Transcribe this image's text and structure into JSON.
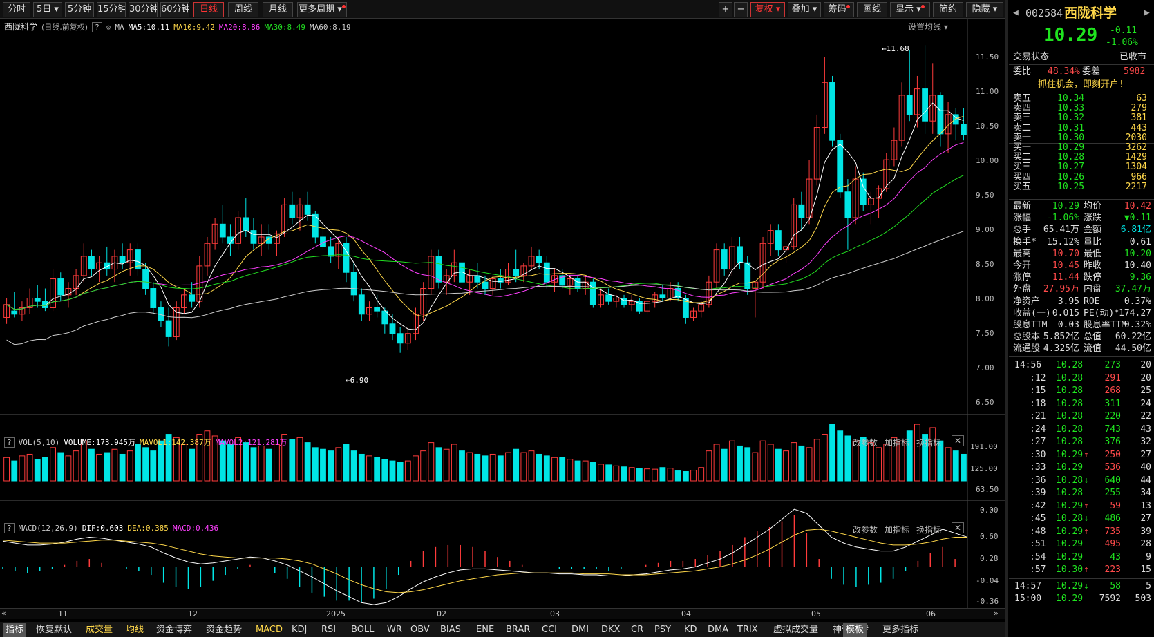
{
  "periods": [
    "分时",
    "5日",
    "5分钟",
    "15分钟",
    "30分钟",
    "60分钟",
    "日线",
    "周线",
    "月线",
    "更多周期"
  ],
  "tools": {
    "plus": "+",
    "minus": "−",
    "fuquan": "复权",
    "overlay": "叠加",
    "chips": "筹码",
    "draw": "画线",
    "display": "显示",
    "simple": "简约",
    "hide": "隐藏"
  },
  "stock": {
    "code": "002584",
    "name": "西陇科学",
    "price": "10.29",
    "change": "-0.11",
    "pct": "-1.06%"
  },
  "main_legend": {
    "title": "西陇科学",
    "subtitle": "(日线,前复权)",
    "q": "?",
    "ma": "MA",
    "ma5": "MA5:10.11",
    "ma10": "MA10:9.42",
    "ma20": "MA20:8.86",
    "ma30": "MA30:8.49",
    "ma60": "MA60:8.19",
    "settings": "设置均线"
  },
  "vol_legend": {
    "q": "?",
    "name": "VOL(5,10)",
    "volume": "VOLUME:173.945万",
    "mavol1": "MAVOL1:142.387万",
    "mavol2": "MAVOL2:121.281万"
  },
  "macd_legend": {
    "q": "?",
    "name": "MACD(12,26,9)",
    "dif": "DIF:0.603",
    "dea": "DEA:0.385",
    "macd": "MACD:0.436"
  },
  "panel_btns": {
    "param": "改参数",
    "add": "加指标",
    "swap": "换指标",
    "close": "✕"
  },
  "price_axis": [
    "11.50",
    "11.00",
    "10.50",
    "10.00",
    "9.50",
    "9.00",
    "8.50",
    "8.00",
    "7.50",
    "7.00",
    "6.50"
  ],
  "vol_axis": [
    "191.00",
    "125.00",
    "63.50",
    "0.00"
  ],
  "macd_axis": [
    "0.60",
    "0.28",
    "-0.04",
    "-0.36"
  ],
  "x_labels": [
    "11",
    "12",
    "2025",
    "02",
    "03",
    "04",
    "05",
    "06"
  ],
  "annot": {
    "high": "11.68",
    "low": "6.90"
  },
  "bottom_tabs": [
    "指标",
    "恢复默认",
    "成交量",
    "均线",
    "资金博弈",
    "资金趋势",
    "MACD",
    "KDJ",
    "RSI",
    "BOLL",
    "WR",
    "OBV",
    "BIAS",
    "ENE",
    "BRAR",
    "CCI",
    "DMI",
    "DKX",
    "CR",
    "PSY",
    "KD",
    "DMA",
    "TRIX",
    "虚拟成交量",
    "神奇九转",
    "更多指标",
    "模板"
  ],
  "quote": {
    "state_label": "交易状态",
    "state": "已收市",
    "wb_label": "委比",
    "wb": "48.34%",
    "wc_label": "委差",
    "wc": "5982",
    "promo": "抓住机会，即刻开户!",
    "asks": [
      [
        "卖五",
        "10.34",
        "63"
      ],
      [
        "卖四",
        "10.33",
        "279"
      ],
      [
        "卖三",
        "10.32",
        "381"
      ],
      [
        "卖二",
        "10.31",
        "443"
      ],
      [
        "卖一",
        "10.30",
        "2030"
      ]
    ],
    "bids": [
      [
        "买一",
        "10.29",
        "3262"
      ],
      [
        "买二",
        "10.28",
        "1429"
      ],
      [
        "买三",
        "10.27",
        "1304"
      ],
      [
        "买四",
        "10.26",
        "966"
      ],
      [
        "买五",
        "10.25",
        "2217"
      ]
    ],
    "stats": [
      [
        "最新",
        "10.29",
        "green",
        "均价",
        "10.42",
        "red"
      ],
      [
        "涨幅",
        "-1.06%",
        "green",
        "涨跌",
        "▼0.11",
        "green"
      ],
      [
        "总手",
        "65.41万",
        "wt",
        "金额",
        "6.81亿",
        "cy"
      ],
      [
        "换手*",
        "15.12%",
        "wt",
        "量比",
        "0.61",
        "wt"
      ],
      [
        "最高",
        "10.70",
        "red",
        "最低",
        "10.20",
        "green"
      ],
      [
        "今开",
        "10.45",
        "red",
        "昨收",
        "10.40",
        "wt"
      ],
      [
        "涨停",
        "11.44",
        "red",
        "跌停",
        "9.36",
        "green"
      ],
      [
        "外盘",
        "27.95万",
        "red",
        "内盘",
        "37.47万",
        "green"
      ],
      [
        "净资产",
        "3.95",
        "wt",
        "ROE",
        "0.37%",
        "wt"
      ],
      [
        "收益(一)",
        "0.015",
        "wt",
        "PE(动)*",
        "174.27",
        "wt"
      ],
      [
        "股息TTM",
        "0.03",
        "wt",
        "股息率TTM",
        "0.32%",
        "wt"
      ],
      [
        "总股本",
        "5.852亿",
        "wt",
        "总值",
        "60.22亿",
        "wt"
      ],
      [
        "流通股",
        "4.325亿",
        "wt",
        "流值",
        "44.50亿",
        "wt"
      ]
    ]
  },
  "ticks": [
    [
      "14:56",
      "10.28",
      "",
      "273",
      "green",
      "20"
    ],
    [
      ":12",
      "10.28",
      "",
      "291",
      "red",
      "20"
    ],
    [
      ":15",
      "10.28",
      "",
      "268",
      "red",
      "25"
    ],
    [
      ":18",
      "10.28",
      "",
      "311",
      "green",
      "24"
    ],
    [
      ":21",
      "10.28",
      "",
      "220",
      "green",
      "22"
    ],
    [
      ":24",
      "10.28",
      "",
      "743",
      "green",
      "43"
    ],
    [
      ":27",
      "10.28",
      "",
      "376",
      "green",
      "32"
    ],
    [
      ":30",
      "10.29",
      "↑",
      "250",
      "red",
      "27"
    ],
    [
      ":33",
      "10.29",
      "",
      "536",
      "red",
      "40"
    ],
    [
      ":36",
      "10.28",
      "↓",
      "640",
      "green",
      "44"
    ],
    [
      ":39",
      "10.28",
      "",
      "255",
      "green",
      "34"
    ],
    [
      ":42",
      "10.29",
      "↑",
      "59",
      "red",
      "13"
    ],
    [
      ":45",
      "10.28",
      "↓",
      "486",
      "green",
      "27"
    ],
    [
      ":48",
      "10.29",
      "↑",
      "735",
      "red",
      "39"
    ],
    [
      ":51",
      "10.29",
      "",
      "495",
      "red",
      "28"
    ],
    [
      ":54",
      "10.29",
      "",
      "43",
      "green",
      "9"
    ],
    [
      ":57",
      "10.30",
      "↑",
      "223",
      "red",
      "15"
    ],
    [
      "14:57",
      "10.29",
      "↓",
      "58",
      "green",
      "5"
    ],
    [
      "15:00",
      "10.29",
      "",
      "7592",
      "wt",
      "503"
    ]
  ],
  "colors": {
    "up": "#ff3b3b",
    "down": "#00e5e5",
    "ma5": "#ffffff",
    "ma10": "#ffd84a",
    "ma20": "#ff40ff",
    "ma30": "#22dd22",
    "ma60": "#cccccc"
  },
  "chart_data": {
    "type": "candlestick",
    "ylim": [
      6.3,
      11.8
    ],
    "ma_values": {
      "MA5": 10.11,
      "MA10": 9.42,
      "MA20": 8.86,
      "MA30": 8.49,
      "MA60": 8.19
    },
    "high_mark": 11.68,
    "low_mark": 6.9,
    "ohlc": [
      [
        7.45,
        7.75,
        7.35,
        7.65
      ],
      [
        7.55,
        7.85,
        7.45,
        7.5
      ],
      [
        7.5,
        7.7,
        7.4,
        7.6
      ],
      [
        7.6,
        7.9,
        7.5,
        7.75
      ],
      [
        7.75,
        7.95,
        7.6,
        7.7
      ],
      [
        7.7,
        7.9,
        7.55,
        7.6
      ],
      [
        7.6,
        8.2,
        7.55,
        8.05
      ],
      [
        8.05,
        8.15,
        7.7,
        7.8
      ],
      [
        7.8,
        8.0,
        7.6,
        7.9
      ],
      [
        7.9,
        8.2,
        7.8,
        8.1
      ],
      [
        8.1,
        8.6,
        8.0,
        8.4
      ],
      [
        8.4,
        8.5,
        8.1,
        8.2
      ],
      [
        8.2,
        8.4,
        8.0,
        8.3
      ],
      [
        8.3,
        8.55,
        8.1,
        8.2
      ],
      [
        8.2,
        8.5,
        8.0,
        8.4
      ],
      [
        8.4,
        8.6,
        8.2,
        8.3
      ],
      [
        8.3,
        8.6,
        8.1,
        8.5
      ],
      [
        8.5,
        8.6,
        8.1,
        8.2
      ],
      [
        8.2,
        8.3,
        7.8,
        7.9
      ],
      [
        7.9,
        8.0,
        7.5,
        7.6
      ],
      [
        7.6,
        7.7,
        7.3,
        7.4
      ],
      [
        7.4,
        7.6,
        7.0,
        7.15
      ],
      [
        7.15,
        7.7,
        7.1,
        7.6
      ],
      [
        7.6,
        7.9,
        7.5,
        7.8
      ],
      [
        7.8,
        8.0,
        7.6,
        7.7
      ],
      [
        7.7,
        8.4,
        7.6,
        8.25
      ],
      [
        8.25,
        8.7,
        8.1,
        8.6
      ],
      [
        8.6,
        9.0,
        8.5,
        8.9
      ],
      [
        8.9,
        9.2,
        8.6,
        8.7
      ],
      [
        8.7,
        8.9,
        8.4,
        8.6
      ],
      [
        8.6,
        9.1,
        8.5,
        9.0
      ],
      [
        9.0,
        9.3,
        8.7,
        8.8
      ],
      [
        8.8,
        9.0,
        8.5,
        8.6
      ],
      [
        8.6,
        8.9,
        8.4,
        8.7
      ],
      [
        8.7,
        8.9,
        8.5,
        8.6
      ],
      [
        8.6,
        8.8,
        8.4,
        8.75
      ],
      [
        8.75,
        9.3,
        8.7,
        9.2
      ],
      [
        9.2,
        9.4,
        8.9,
        9.0
      ],
      [
        9.0,
        9.3,
        8.8,
        9.2
      ],
      [
        9.2,
        9.4,
        8.95,
        9.05
      ],
      [
        9.05,
        9.1,
        8.6,
        8.7
      ],
      [
        8.7,
        8.9,
        8.5,
        8.55
      ],
      [
        8.55,
        8.7,
        8.3,
        8.4
      ],
      [
        8.4,
        8.7,
        8.2,
        8.6
      ],
      [
        8.6,
        8.7,
        8.0,
        8.15
      ],
      [
        8.15,
        8.3,
        7.7,
        7.8
      ],
      [
        7.8,
        7.9,
        7.4,
        7.5
      ],
      [
        7.5,
        7.7,
        7.4,
        7.6
      ],
      [
        7.6,
        7.8,
        7.45,
        7.55
      ],
      [
        7.55,
        7.6,
        7.2,
        7.35
      ],
      [
        7.35,
        7.5,
        7.1,
        7.2
      ],
      [
        7.2,
        7.3,
        6.9,
        7.05
      ],
      [
        7.05,
        7.3,
        6.95,
        7.2
      ],
      [
        7.2,
        7.6,
        7.1,
        7.5
      ],
      [
        7.5,
        8.0,
        7.4,
        7.9
      ],
      [
        7.9,
        8.5,
        7.8,
        8.4
      ],
      [
        8.4,
        8.5,
        7.9,
        8.0
      ],
      [
        8.0,
        8.2,
        7.8,
        8.1
      ],
      [
        8.1,
        8.5,
        8.0,
        8.3
      ],
      [
        8.3,
        8.4,
        7.9,
        8.0
      ],
      [
        8.0,
        8.2,
        7.8,
        8.1
      ],
      [
        8.1,
        8.3,
        7.9,
        8.0
      ],
      [
        8.0,
        8.1,
        7.8,
        7.9
      ],
      [
        7.9,
        8.1,
        7.8,
        8.05
      ],
      [
        8.05,
        8.2,
        7.9,
        8.0
      ],
      [
        8.0,
        8.3,
        7.95,
        8.2
      ],
      [
        8.2,
        8.5,
        8.0,
        8.1
      ],
      [
        8.1,
        8.3,
        8.0,
        8.25
      ],
      [
        8.25,
        8.55,
        8.2,
        8.4
      ],
      [
        8.4,
        8.5,
        8.2,
        8.3
      ],
      [
        8.3,
        8.4,
        7.9,
        8.0
      ],
      [
        8.0,
        8.2,
        7.85,
        8.1
      ],
      [
        8.1,
        8.2,
        7.9,
        7.95
      ],
      [
        7.95,
        8.1,
        7.8,
        8.05
      ],
      [
        8.05,
        8.1,
        7.85,
        7.9
      ],
      [
        7.9,
        8.1,
        7.8,
        8.0
      ],
      [
        8.0,
        8.05,
        7.6,
        7.65
      ],
      [
        7.65,
        7.9,
        7.6,
        7.8
      ],
      [
        7.8,
        7.9,
        7.65,
        7.7
      ],
      [
        7.7,
        7.8,
        7.6,
        7.75
      ],
      [
        7.75,
        7.8,
        7.6,
        7.65
      ],
      [
        7.65,
        7.8,
        7.55,
        7.7
      ],
      [
        7.7,
        7.75,
        7.5,
        7.55
      ],
      [
        7.55,
        7.8,
        7.5,
        7.7
      ],
      [
        7.7,
        7.85,
        7.6,
        7.8
      ],
      [
        7.8,
        7.95,
        7.7,
        7.75
      ],
      [
        7.75,
        8.0,
        7.7,
        7.9
      ],
      [
        7.9,
        8.0,
        7.7,
        7.75
      ],
      [
        7.75,
        7.8,
        7.35,
        7.45
      ],
      [
        7.45,
        7.6,
        7.4,
        7.55
      ],
      [
        7.55,
        7.7,
        7.45,
        7.65
      ],
      [
        7.65,
        8.1,
        7.6,
        8.0
      ],
      [
        8.0,
        8.6,
        7.9,
        8.5
      ],
      [
        8.5,
        8.6,
        8.1,
        8.2
      ],
      [
        8.2,
        8.7,
        8.1,
        8.55
      ],
      [
        8.55,
        8.7,
        8.2,
        8.3
      ],
      [
        8.3,
        8.4,
        7.8,
        7.9
      ],
      [
        7.9,
        8.0,
        7.45,
        8.0
      ],
      [
        8.0,
        8.7,
        7.9,
        8.6
      ],
      [
        8.6,
        8.9,
        8.4,
        8.8
      ],
      [
        8.8,
        8.9,
        8.4,
        8.5
      ],
      [
        8.5,
        8.6,
        8.3,
        8.55
      ],
      [
        8.55,
        9.3,
        8.5,
        9.2
      ],
      [
        9.2,
        9.4,
        8.8,
        9.0
      ],
      [
        9.0,
        9.9,
        8.9,
        9.6
      ],
      [
        9.6,
        10.6,
        9.5,
        10.4
      ],
      [
        10.4,
        11.5,
        10.3,
        11.1
      ],
      [
        11.1,
        11.2,
        10.1,
        10.2
      ],
      [
        10.2,
        10.3,
        9.3,
        9.4
      ],
      [
        9.4,
        9.6,
        8.5,
        9.0
      ],
      [
        9.0,
        9.8,
        8.9,
        9.6
      ],
      [
        9.6,
        9.7,
        9.1,
        9.2
      ],
      [
        9.2,
        9.4,
        8.9,
        9.3
      ],
      [
        9.3,
        9.5,
        9.0,
        9.45
      ],
      [
        9.45,
        10.0,
        9.4,
        9.9
      ],
      [
        9.9,
        10.4,
        9.8,
        10.2
      ],
      [
        10.2,
        11.1,
        10.1,
        10.9
      ],
      [
        10.9,
        11.6,
        10.5,
        10.6
      ],
      [
        10.6,
        11.2,
        10.4,
        11.0
      ],
      [
        11.0,
        11.68,
        10.3,
        10.5
      ],
      [
        10.5,
        11.4,
        10.3,
        10.9
      ],
      [
        10.9,
        10.95,
        10.1,
        10.3
      ],
      [
        10.3,
        10.8,
        10.0,
        10.6
      ],
      [
        10.6,
        10.7,
        10.2,
        10.45
      ],
      [
        10.45,
        10.7,
        10.2,
        10.29
      ]
    ],
    "volume": [
      70,
      60,
      75,
      80,
      65,
      70,
      100,
      85,
      75,
      90,
      120,
      95,
      80,
      85,
      95,
      80,
      90,
      110,
      100,
      90,
      120,
      140,
      130,
      110,
      95,
      140,
      150,
      135,
      120,
      110,
      130,
      115,
      100,
      105,
      95,
      110,
      140,
      125,
      130,
      115,
      100,
      95,
      90,
      100,
      110,
      90,
      80,
      75,
      70,
      65,
      60,
      55,
      60,
      75,
      90,
      115,
      100,
      95,
      110,
      90,
      85,
      80,
      75,
      80,
      75,
      85,
      95,
      85,
      90,
      80,
      75,
      70,
      70,
      65,
      60,
      60,
      55,
      50,
      48,
      45,
      42,
      40,
      38,
      36,
      35,
      40,
      38,
      30,
      28,
      32,
      40,
      90,
      110,
      95,
      120,
      105,
      100,
      85,
      120,
      110,
      95,
      90,
      115,
      105,
      100,
      125,
      140,
      170,
      150,
      135,
      120,
      130,
      115,
      100,
      110,
      130,
      120,
      150,
      170,
      140,
      160,
      120,
      100,
      90,
      80
    ],
    "macd_dif": [
      0.26,
      0.24,
      0.22,
      0.22,
      0.23,
      0.25,
      0.28,
      0.3,
      0.29,
      0.27,
      0.25,
      0.23,
      0.2,
      0.14,
      0.09,
      0.05,
      0.03,
      0.04,
      0.06,
      0.08,
      0.1,
      0.09,
      0.06,
      0.02,
      -0.04,
      -0.1,
      -0.17,
      -0.24,
      -0.3,
      -0.36,
      -0.38,
      -0.36,
      -0.3,
      -0.22,
      -0.15,
      -0.1,
      -0.06,
      -0.03,
      -0.02,
      -0.02,
      -0.03,
      -0.04,
      -0.05,
      -0.06,
      -0.06,
      -0.07,
      -0.07,
      -0.08,
      -0.08,
      -0.09,
      -0.09,
      -0.08,
      -0.07,
      -0.05,
      -0.03,
      -0.02,
      0.0,
      0.04,
      0.08,
      0.14,
      0.22,
      0.3,
      0.38,
      0.48,
      0.58,
      0.54,
      0.42,
      0.3,
      0.24,
      0.2,
      0.18,
      0.16,
      0.16,
      0.2,
      0.26,
      0.32,
      0.38,
      0.34,
      0.3
    ],
    "macd_dea": [
      0.27,
      0.26,
      0.25,
      0.24,
      0.24,
      0.24,
      0.25,
      0.26,
      0.27,
      0.27,
      0.26,
      0.25,
      0.24,
      0.22,
      0.19,
      0.16,
      0.13,
      0.11,
      0.1,
      0.09,
      0.09,
      0.09,
      0.09,
      0.08,
      0.06,
      0.03,
      -0.02,
      -0.07,
      -0.13,
      -0.18,
      -0.22,
      -0.25,
      -0.26,
      -0.25,
      -0.23,
      -0.2,
      -0.17,
      -0.14,
      -0.12,
      -0.1,
      -0.08,
      -0.07,
      -0.06,
      -0.06,
      -0.06,
      -0.06,
      -0.06,
      -0.07,
      -0.07,
      -0.07,
      -0.08,
      -0.08,
      -0.08,
      -0.07,
      -0.06,
      -0.05,
      -0.04,
      -0.02,
      0.0,
      0.03,
      0.07,
      0.12,
      0.18,
      0.25,
      0.32,
      0.37,
      0.38,
      0.36,
      0.33,
      0.3,
      0.27,
      0.24,
      0.22,
      0.22,
      0.23,
      0.25,
      0.28,
      0.3,
      0.3
    ]
  }
}
